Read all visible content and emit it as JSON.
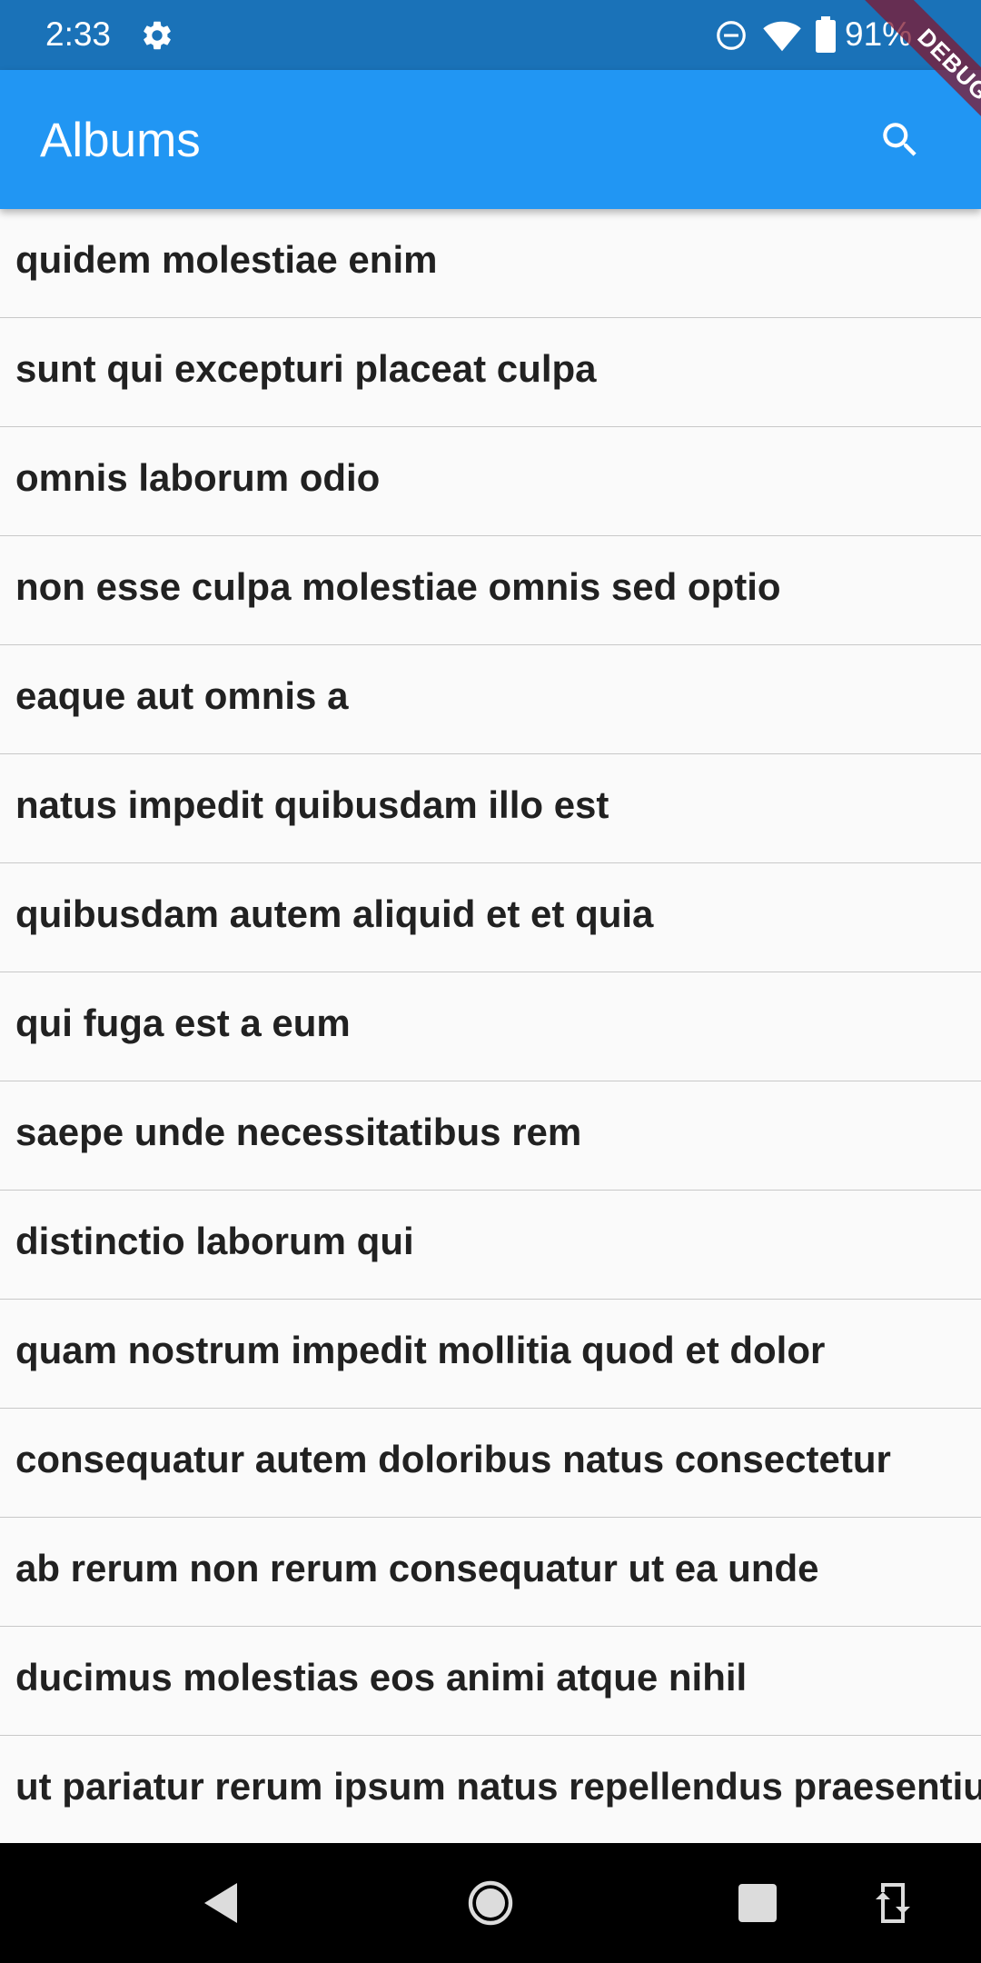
{
  "status_bar": {
    "time": "2:33",
    "battery": "91%",
    "icons": [
      "settings-icon",
      "do-not-disturb-icon",
      "wifi-icon",
      "battery-icon"
    ],
    "background": "#1a72b8"
  },
  "app_bar": {
    "title": "Albums",
    "search_icon": "search-icon",
    "background": "#2196f3"
  },
  "debug_banner": {
    "label": "DEBUG",
    "color": "#801830"
  },
  "albums": [
    {
      "title": "quidem molestiae enim"
    },
    {
      "title": "sunt qui excepturi placeat culpa"
    },
    {
      "title": "omnis laborum odio"
    },
    {
      "title": "non esse culpa molestiae omnis sed optio"
    },
    {
      "title": "eaque aut omnis a"
    },
    {
      "title": "natus impedit quibusdam illo est"
    },
    {
      "title": "quibusdam autem aliquid et et quia"
    },
    {
      "title": "qui fuga est a eum"
    },
    {
      "title": "saepe unde necessitatibus rem"
    },
    {
      "title": "distinctio laborum qui"
    },
    {
      "title": "quam nostrum impedit mollitia quod et dolor"
    },
    {
      "title": "consequatur autem doloribus natus consectetur"
    },
    {
      "title": "ab rerum non rerum consequatur ut ea unde"
    },
    {
      "title": "ducimus molestias eos animi atque nihil"
    },
    {
      "title": "ut pariatur rerum ipsum natus repellendus praesentium"
    }
  ],
  "nav_bar": {
    "buttons": [
      "back-icon",
      "home-icon",
      "recents-icon",
      "rotate-icon"
    ]
  }
}
